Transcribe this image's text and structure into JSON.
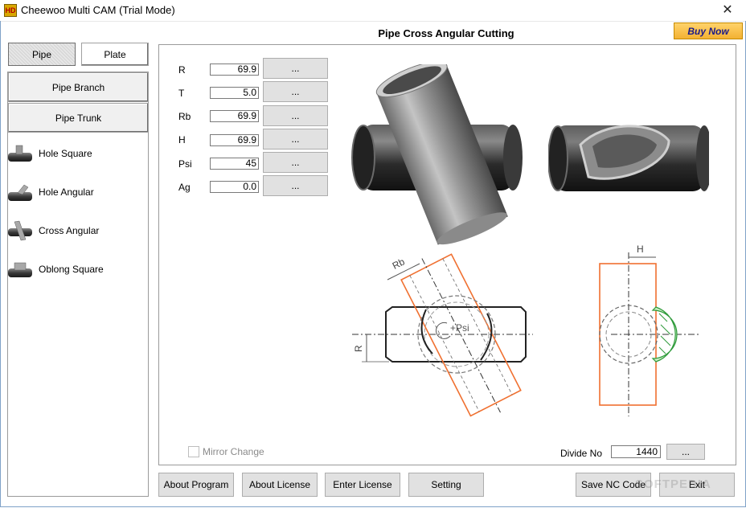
{
  "window": {
    "title": "Cheewoo Multi CAM (Trial Mode)",
    "app_icon": "HD"
  },
  "header": {
    "title": "Pipe  Cross Angular Cutting",
    "buy_now": "Buy Now"
  },
  "mode_tabs": {
    "pipe": "Pipe",
    "plate": "Plate"
  },
  "categories": {
    "branch": "Pipe Branch",
    "trunk": "Pipe Trunk"
  },
  "nav_items": [
    {
      "label": "Hole Square",
      "icon": "pipe-hole-square-icon"
    },
    {
      "label": "Hole Angular",
      "icon": "pipe-hole-angular-icon"
    },
    {
      "label": "Cross Angular",
      "icon": "pipe-cross-angular-icon"
    },
    {
      "label": "Oblong Square",
      "icon": "pipe-oblong-square-icon"
    }
  ],
  "params": [
    {
      "label": "R",
      "value": "69.9",
      "button": "..."
    },
    {
      "label": "T",
      "value": "5.0",
      "button": "..."
    },
    {
      "label": "Rb",
      "value": "69.9",
      "button": "..."
    },
    {
      "label": "H",
      "value": "69.9",
      "button": "..."
    },
    {
      "label": "Psi",
      "value": "45",
      "button": "..."
    },
    {
      "label": "Ag",
      "value": "0.0",
      "button": "..."
    }
  ],
  "drawing": {
    "rb_label": "Rb",
    "r_label": "R",
    "psi_label": "+Psi",
    "h_label": "H"
  },
  "mirror_change": "Mirror Change",
  "divide": {
    "label": "Divide No",
    "value": "1440",
    "button": "..."
  },
  "footer": {
    "about_program": "About Program",
    "about_license": "About License",
    "enter_license": "Enter License",
    "setting": "Setting",
    "save_nc": "Save NC Code",
    "exit": "Exit"
  },
  "watermark": "SOFTPEDIA",
  "colors": {
    "accent_orange": "#f07030",
    "buy_now": "#f3b133",
    "hatch_green": "#2e9a3a"
  }
}
